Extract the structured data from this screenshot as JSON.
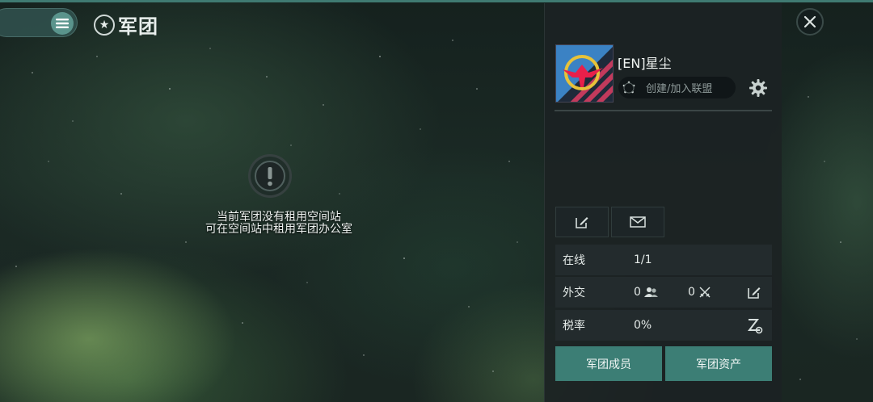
{
  "header": {
    "title": "军团",
    "menu_icon": "list-icon",
    "title_icon": "star-circle-icon",
    "close_icon": "close-icon"
  },
  "empty_state": {
    "icon": "exclamation-icon",
    "line1": "当前军团没有租用空间站",
    "line2": "可在空间站中租用军团办公室"
  },
  "corp": {
    "name": "[EN]星尘",
    "alliance_button": "创建/加入联盟",
    "alliance_icon": "stars-ring-icon",
    "settings_icon": "gear-icon",
    "logo_icon": "eagle-emblem-icon"
  },
  "actions": [
    {
      "icon": "edit-icon"
    },
    {
      "icon": "mail-icon"
    }
  ],
  "stats": {
    "online": {
      "label": "在线",
      "value": "1/1"
    },
    "diplomacy": {
      "label": "外交",
      "allies": "0",
      "enemies": "0"
    },
    "tax": {
      "label": "税率",
      "value": "0%"
    }
  },
  "buttons": {
    "members": "军团成员",
    "assets": "军团资产"
  },
  "colors": {
    "accent": "#3c7e75",
    "panel": "#1c2224",
    "top_strip": "#3f7a72"
  }
}
